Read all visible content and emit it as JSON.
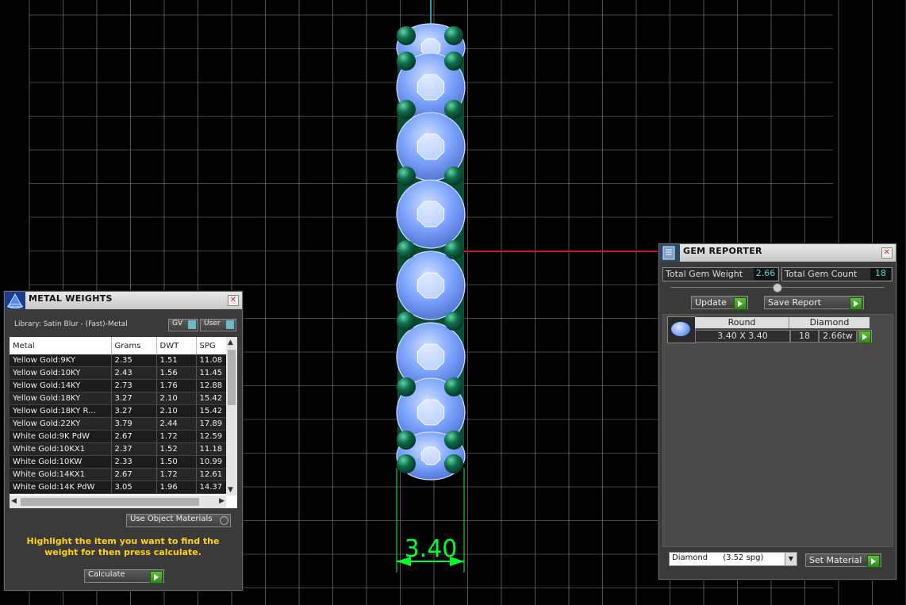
{
  "dimension": {
    "value": "3.40"
  },
  "metal_weights": {
    "title": "METAL WEIGHTS",
    "library": "Library: Satin Blur - (Fast)-Metal",
    "gv_label": "GV",
    "user_label": "User",
    "columns": [
      "Metal",
      "Grams",
      "DWT",
      "SPG"
    ],
    "rows": [
      [
        "Yellow Gold:9KY",
        "2.35",
        "1.51",
        "11.08"
      ],
      [
        "Yellow Gold:10KY",
        "2.43",
        "1.56",
        "11.45"
      ],
      [
        "Yellow Gold:14KY",
        "2.73",
        "1.76",
        "12.88"
      ],
      [
        "Yellow Gold:18KY",
        "3.27",
        "2.10",
        "15.42"
      ],
      [
        "Yellow Gold:18KY R...",
        "3.27",
        "2.10",
        "15.42"
      ],
      [
        "Yellow Gold:22KY",
        "3.79",
        "2.44",
        "17.89"
      ],
      [
        "White Gold:9K PdW",
        "2.67",
        "1.72",
        "12.59"
      ],
      [
        "White Gold:10KX1",
        "2.37",
        "1.52",
        "11.18"
      ],
      [
        "White Gold:10KW",
        "2.33",
        "1.50",
        "10.99"
      ],
      [
        "White Gold:14KX1",
        "2.67",
        "1.72",
        "12.61"
      ],
      [
        "White Gold:14K PdW",
        "3.05",
        "1.96",
        "14.37"
      ]
    ],
    "use_object_materials": "Use Object Materials",
    "instruction": "Highlight the item you want to find the weight for then press calculate.",
    "calculate_label": "Calculate"
  },
  "gem_reporter": {
    "title": "GEM REPORTER",
    "total_weight_label": "Total Gem Weight",
    "total_weight_value": "2.66",
    "total_count_label": "Total Gem Count",
    "total_count_value": "18",
    "update_label": "Update",
    "save_report_label": "Save Report",
    "gem": {
      "shape": "Round",
      "material": "Diamond",
      "size": "3.40 X 3.40",
      "count": "18",
      "weight": "2.66tw"
    },
    "material_select": "Diamond      (3.52 spg)",
    "set_material_label": "Set Material"
  },
  "colors": {
    "grid": "#8a8a8a",
    "gem_blue": "#7fa6ff",
    "prong_green": "#0f6b4a",
    "dimension_green": "#00ff2a",
    "instruction_yellow": "#ffd21a",
    "axis_red": "#c02020",
    "axis_teal": "#1aa0a0"
  }
}
